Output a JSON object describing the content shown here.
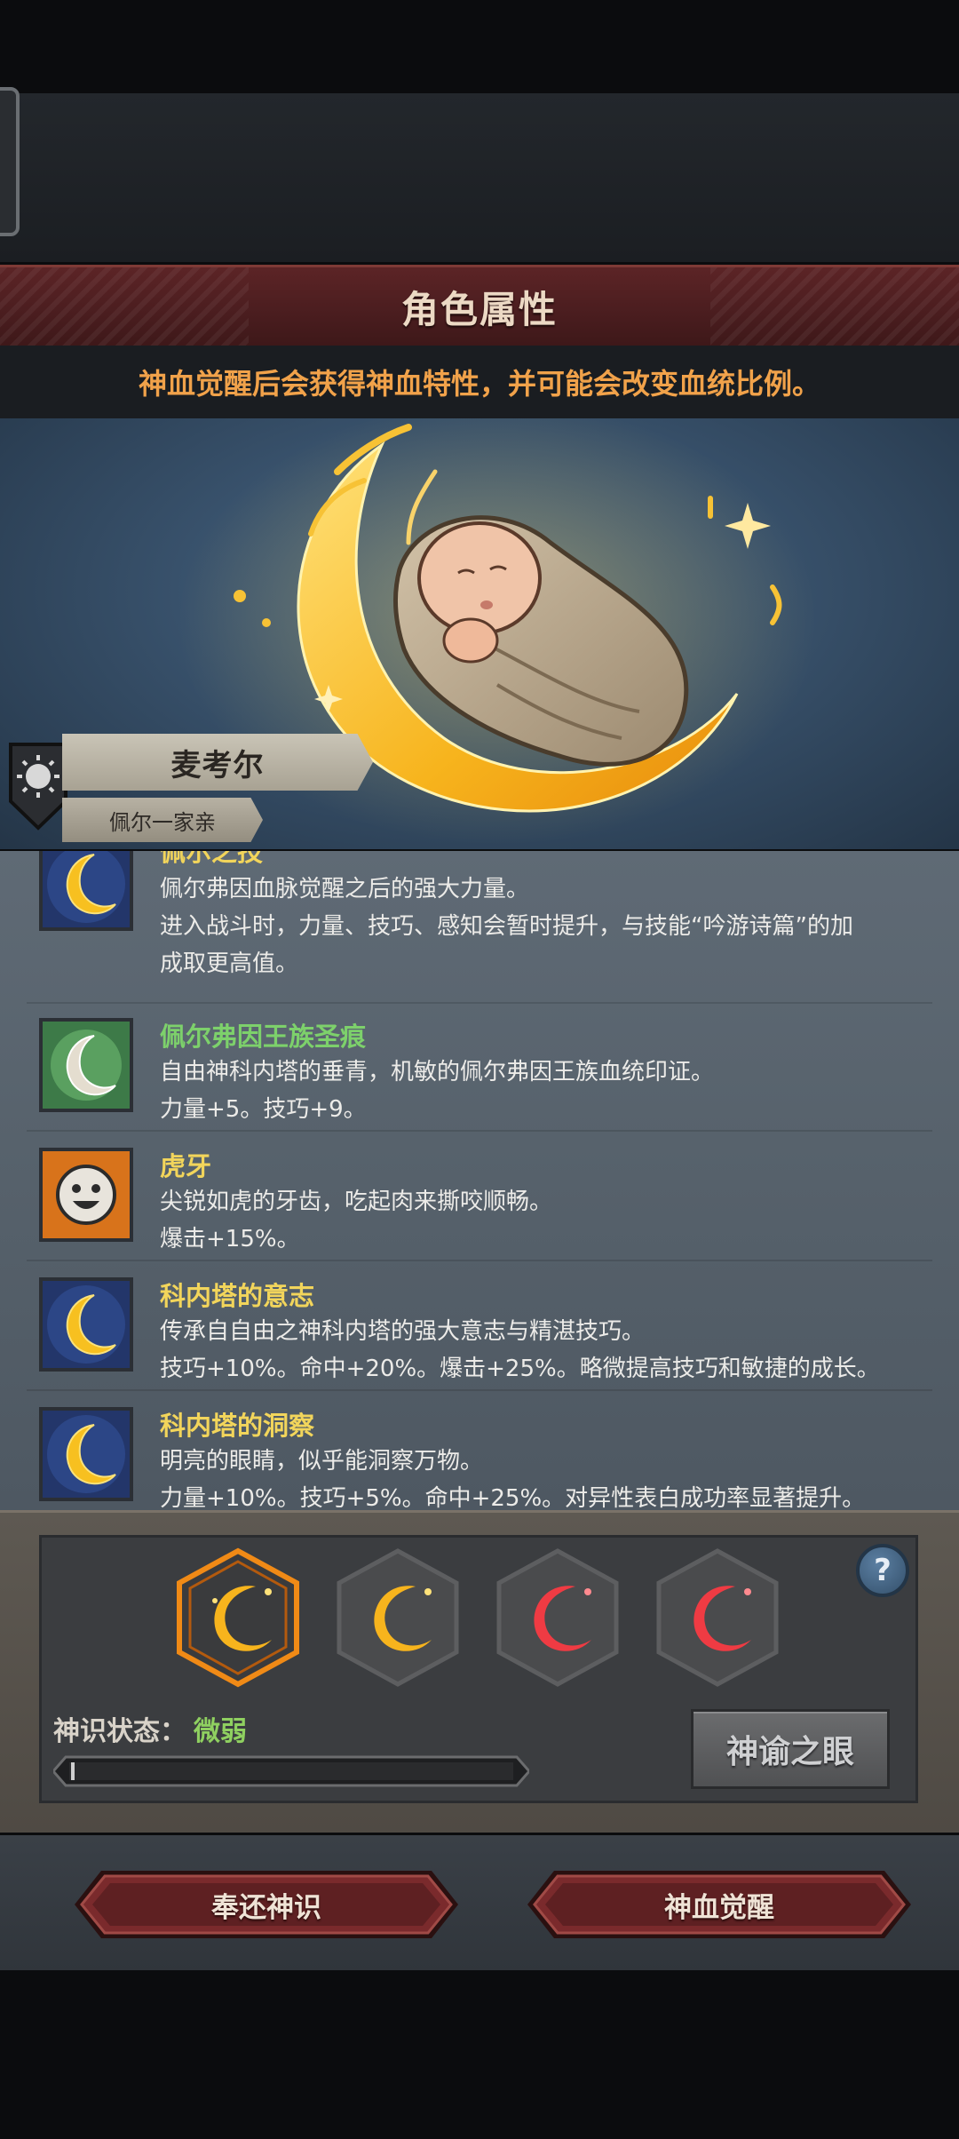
{
  "header": {
    "title": "角色属性",
    "subtitle": "神血觉醒后会获得神血特性，并可能会改变血统比例。"
  },
  "character": {
    "name": "麦考尔",
    "family": "佩尔一家亲"
  },
  "traits": [
    {
      "icon": "golden-crescent-icon",
      "name": "佩尔之技",
      "name_color": "#f2d55b",
      "lines": [
        "佩尔弗因血脉觉醒之后的强大力量。",
        "进入战斗时，力量、技巧、感知会暂时提升，与技能“吟游诗篇”的加",
        "成取更高值。"
      ]
    },
    {
      "icon": "silver-crescent-icon",
      "name": "佩尔弗因王族圣痕",
      "name_color": "#7dd16b",
      "lines": [
        "自由神科内塔的垂青，机敏的佩尔弗因王族血统印证。",
        "力量+5。技巧+9。"
      ]
    },
    {
      "icon": "grinning-face-icon",
      "name": "虎牙",
      "name_color": "#f2d55b",
      "lines": [
        "尖锐如虎的牙齿，吃起肉来撕咬顺畅。",
        "爆击+15%。"
      ]
    },
    {
      "icon": "golden-crescent-icon",
      "name": "科内塔的意志",
      "name_color": "#f2d55b",
      "lines": [
        "传承自自由之神科内塔的强大意志与精湛技巧。",
        "技巧+10%。命中+20%。爆击+25%。略微提高技巧和敏捷的成长。"
      ]
    },
    {
      "icon": "golden-crescent-icon",
      "name": "科内塔的洞察",
      "name_color": "#f2d55b",
      "lines": [
        "明亮的眼睛，似乎能洞察万物。",
        "力量+10%。技巧+5%。命中+25%。对异性表白成功率显著提升。"
      ]
    }
  ],
  "awakening": {
    "slots": [
      {
        "icon": "gold-crescent-slot-icon",
        "color": "#f7b41d",
        "selected": true
      },
      {
        "icon": "gold-crescent-slot-icon",
        "color": "#f7b41d",
        "selected": false
      },
      {
        "icon": "red-crescent-slot-icon",
        "color": "#ef3b43",
        "selected": false
      },
      {
        "icon": "red-crescent-slot-icon",
        "color": "#ef3b43",
        "selected": false
      }
    ],
    "status_label": "神识状态：",
    "status_value": "微弱",
    "progress": 0.0,
    "oracle_button": "神谕之眼",
    "help_icon": "question-mark-icon"
  },
  "actions": {
    "return_label": "奉还神识",
    "awaken_label": "神血觉醒"
  },
  "colors": {
    "title_bar": "#4a1d1f",
    "subtitle_text": "#f1a24a",
    "crescent_gold": "#f7b41d",
    "crescent_red": "#ef3b43"
  }
}
